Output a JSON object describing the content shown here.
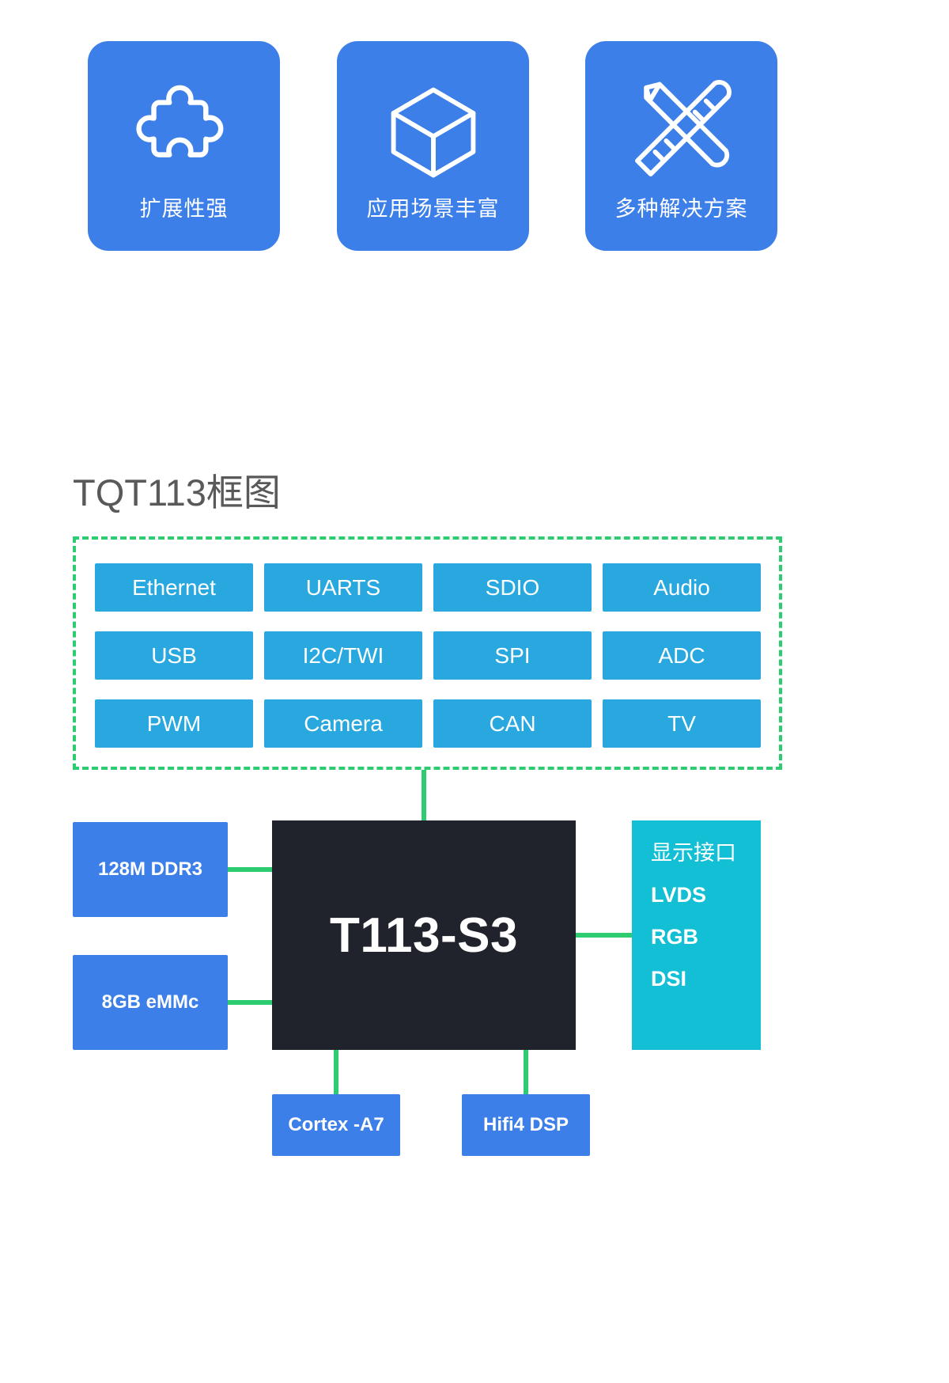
{
  "features": [
    {
      "icon": "puzzle-piece-icon",
      "label": "扩展性强"
    },
    {
      "icon": "cube-icon",
      "label": "应用场景丰富"
    },
    {
      "icon": "pencil-ruler-icon",
      "label": "多种解决方案"
    }
  ],
  "block_diagram": {
    "title": "TQT113框图",
    "peripherals": [
      "Ethernet",
      "UARTS",
      "SDIO",
      "Audio",
      "USB",
      "I2C/TWI",
      "SPI",
      "ADC",
      "PWM",
      "Camera",
      "CAN",
      "TV"
    ],
    "soc": "T113-S3",
    "memory": [
      "128M DDR3",
      "8GB eMMc"
    ],
    "display_interface": [
      "显示接口",
      "LVDS",
      "RGB",
      "DSI"
    ],
    "processing_units": [
      "Cortex -A7",
      "Hifi4 DSP"
    ]
  },
  "colors": {
    "card_blue": "#3d7fe8",
    "peripheral_blue": "#29a8e0",
    "connector_green": "#2ecc71",
    "soc_dark": "#21232c",
    "display_cyan": "#12bfd4",
    "title_gray": "#595959"
  }
}
